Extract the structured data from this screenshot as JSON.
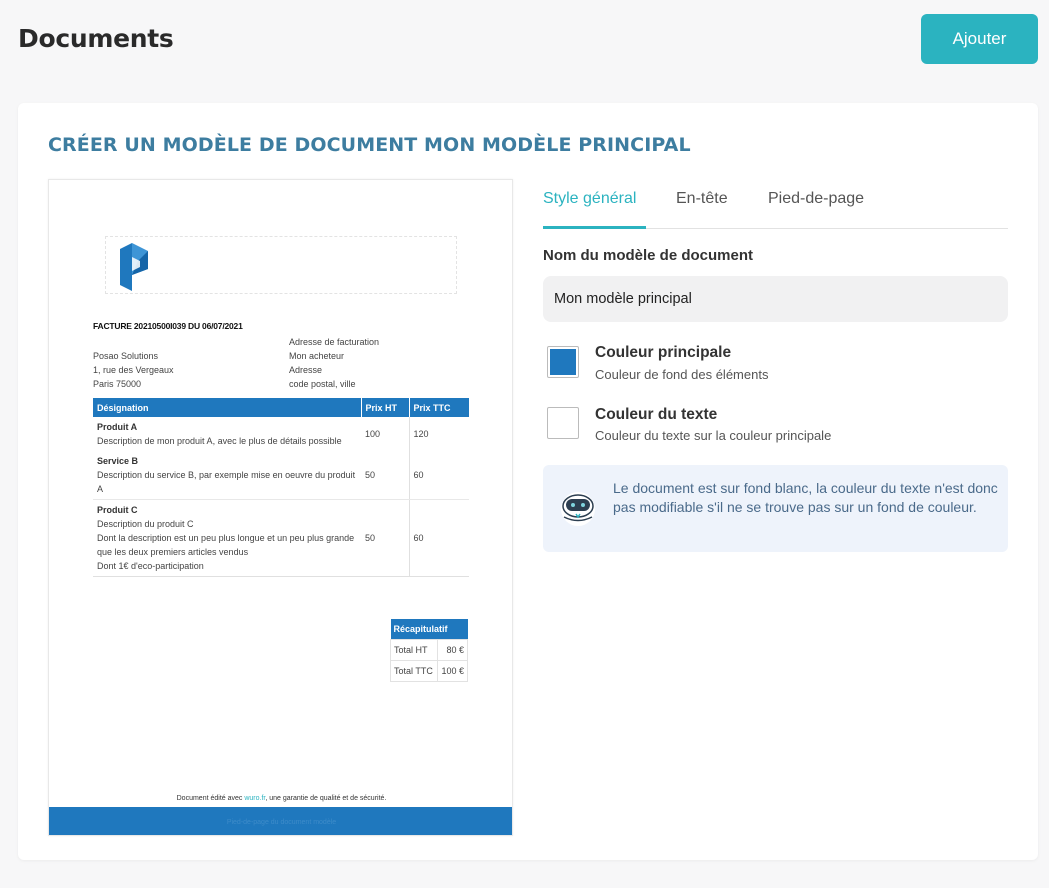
{
  "header": {
    "title": "Documents",
    "add_label": "Ajouter"
  },
  "card": {
    "title": "CRÉER UN MODÈLE DE DOCUMENT MON MODÈLE PRINCIPAL"
  },
  "preview": {
    "invoice_title": "FACTURE 20210500I039 DU 06/07/2021",
    "seller": [
      "Posao Solutions",
      "1, rue des Vergeaux",
      "Paris 75000"
    ],
    "buyer": [
      "Adresse de facturation",
      "Mon acheteur",
      "Adresse",
      "code postal, ville"
    ],
    "table_headers": [
      "Désignation",
      "Prix HT",
      "Prix TTC"
    ],
    "items": [
      {
        "name": "Produit A",
        "desc": [
          "Description de mon produit A, avec le plus de détails possible"
        ],
        "ht": "100",
        "ttc": "120"
      },
      {
        "name": "Service B",
        "desc": [
          "Description du service B, par exemple mise en oeuvre du produit A"
        ],
        "ht": "50",
        "ttc": "60"
      },
      {
        "name": "Produit C",
        "desc": [
          "Description du produit C",
          "Dont la description est un peu plus longue et un peu plus grande",
          "que les deux premiers articles vendus",
          "Dont 1€ d'eco-participation"
        ],
        "ht": "50",
        "ttc": "60"
      }
    ],
    "recap": {
      "title": "Récapitulatif",
      "rows": [
        {
          "label": "Total HT",
          "value": "80 €"
        },
        {
          "label": "Total TTC",
          "value": "100 €"
        }
      ]
    },
    "footer_note_prefix": "Document édité avec ",
    "footer_note_link": "wuro.fr",
    "footer_note_suffix": ", une garantie de qualité et de sécurité.",
    "footer_bar_text": "Pied-de-page du document modèle",
    "brand_color": "#1f78be"
  },
  "tabs": [
    {
      "label": "Style général",
      "active": true
    },
    {
      "label": "En-tête",
      "active": false
    },
    {
      "label": "Pied-de-page",
      "active": false
    }
  ],
  "form": {
    "name_label": "Nom du modèle de document",
    "name_value": "Mon modèle principal"
  },
  "colors": {
    "primary": {
      "label": "Couleur principale",
      "sub": "Couleur de fond des éléments",
      "value": "#1f78be"
    },
    "text": {
      "label": "Couleur du texte",
      "sub": "Couleur du texte sur la couleur principale",
      "value": "#ffffff"
    }
  },
  "info": {
    "icon": "robot-icon",
    "text": "Le document est sur fond blanc, la couleur du texte n'est donc pas modifiable s'il ne se trouve pas sur un fond de couleur."
  },
  "accent_color": "#2bb3c0"
}
